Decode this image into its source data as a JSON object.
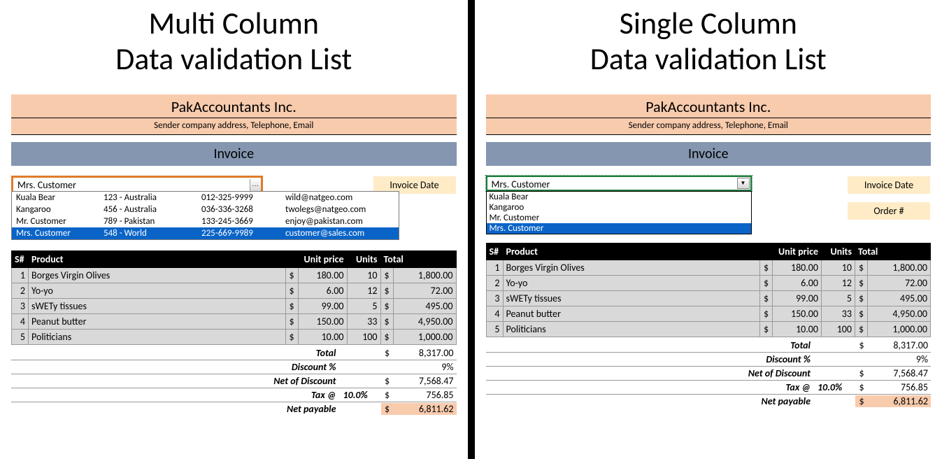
{
  "left": {
    "title_line1": "Multi Column",
    "title_line2": "Data validation List",
    "company": "PakAccountants Inc.",
    "company_sub": "Sender company address, Telephone, Email",
    "invoice_label": "Invoice",
    "invoice_date_label": "Invoice Date",
    "combo_value": "Mrs. Customer",
    "combo_btn": "...",
    "options": [
      {
        "name": "Kuala Bear",
        "addr": "123 - Australia",
        "phone": "012-325-9999",
        "email": "wild@natgeo.com",
        "selected": false
      },
      {
        "name": "Kangaroo",
        "addr": "456 - Australia",
        "phone": "036-336-3268",
        "email": "twolegs@natgeo.com",
        "selected": false
      },
      {
        "name": "Mr. Customer",
        "addr": "789 - Pakistan",
        "phone": "133-245-3669",
        "email": "enjoy@pakistan.com",
        "selected": false
      },
      {
        "name": "Mrs. Customer",
        "addr": "548 - World",
        "phone": "225-669-9989",
        "email": "customer@sales.com",
        "selected": true
      }
    ]
  },
  "right": {
    "title_line1": "Single Column",
    "title_line2": "Data validation List",
    "company": "PakAccountants Inc.",
    "company_sub": "Sender company address, Telephone, Email",
    "invoice_label": "Invoice",
    "invoice_date_label": "Invoice Date",
    "order_label": "Order #",
    "combo_value": "Mrs. Customer",
    "options": [
      {
        "name": "Kuala Bear",
        "selected": false
      },
      {
        "name": "Kangaroo",
        "selected": false
      },
      {
        "name": "Mr. Customer",
        "selected": false
      },
      {
        "name": "Mrs. Customer",
        "selected": true
      }
    ]
  },
  "invoice": {
    "headers": {
      "s": "S#",
      "product": "Product",
      "unit_price": "Unit price",
      "units": "Units",
      "total": "Total"
    },
    "currency": "$",
    "rows": [
      {
        "s": "1",
        "product": "Borges Virgin Olives",
        "price": "180.00",
        "units": "10",
        "total": "1,800.00"
      },
      {
        "s": "2",
        "product": "Yo-yo",
        "price": "6.00",
        "units": "12",
        "total": "72.00"
      },
      {
        "s": "3",
        "product": "sWETy tissues",
        "price": "99.00",
        "units": "5",
        "total": "495.00"
      },
      {
        "s": "4",
        "product": "Peanut butter",
        "price": "150.00",
        "units": "33",
        "total": "4,950.00"
      },
      {
        "s": "5",
        "product": "Politicians",
        "price": "10.00",
        "units": "100",
        "total": "1,000.00"
      }
    ],
    "totals": {
      "total_label": "Total",
      "total_val": "8,317.00",
      "discount_label": "Discount %",
      "discount_val": "9%",
      "net_disc_label": "Net of Discount",
      "net_disc_val": "7,568.47",
      "tax_label": "Tax @",
      "tax_pct": "10.0%",
      "tax_val": "756.85",
      "net_pay_label": "Net payable",
      "net_pay_val": "6,811.62"
    }
  }
}
